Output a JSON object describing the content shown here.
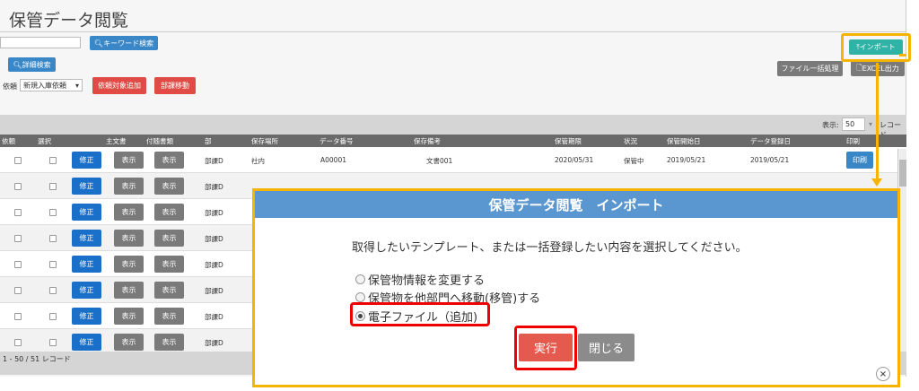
{
  "page": {
    "title": "保管データ閲覧",
    "keyword_search_button": "キーワード検索",
    "detail_search_button": "詳細検索",
    "request_label": "依頼",
    "request_select_value": "新規入庫依頼",
    "add_request_target_button": "依頼対象追加",
    "dept_move_button": "部課移動",
    "import_button": "インポート",
    "file_bulk_button": "ファイル一括処理",
    "excel_button": "EXCEL出力"
  },
  "grid": {
    "display_label": "表示:",
    "display_value": "50",
    "records_label": "レコード",
    "headers": [
      "依頼",
      "選択",
      "主文書",
      "付随書類",
      "部",
      "保存場所",
      "データ番号",
      "保存備考",
      "保管期限",
      "状況",
      "保管開始日",
      "データ登録日",
      "印刷"
    ],
    "edit_label": "修正",
    "show_label": "表示",
    "print_label": "印刷",
    "rows": [
      {
        "dept": "部課D",
        "place": "社内",
        "num": "A00001",
        "note": "文書001",
        "expiry": "2020/05/31",
        "status": "保管中",
        "start": "2019/05/21",
        "reg": "2019/05/21"
      },
      {
        "dept": "部課D"
      },
      {
        "dept": "部課D"
      },
      {
        "dept": "部課D"
      },
      {
        "dept": "部課D"
      },
      {
        "dept": "部課D"
      },
      {
        "dept": "部課D"
      },
      {
        "dept": "部課D"
      }
    ],
    "footer_text": "1 - 50 / 51 レコード"
  },
  "modal": {
    "title": "保管データ閲覧　インポート",
    "message": "取得したいテンプレート、または一括登録したい内容を選択してください。",
    "options": [
      "保管物情報を変更する",
      "保管物を他部門へ移動(移管)する",
      "電子ファイル（追加)"
    ],
    "selected_index": 2,
    "execute_button": "実行",
    "close_button": "閉じる",
    "close_icon_glyph": "×"
  },
  "colors": {
    "highlight_red": "#e00000",
    "highlight_yellow": "#f5b400",
    "modal_header": "#5a96cf",
    "import_button": "#2fb3a6"
  }
}
